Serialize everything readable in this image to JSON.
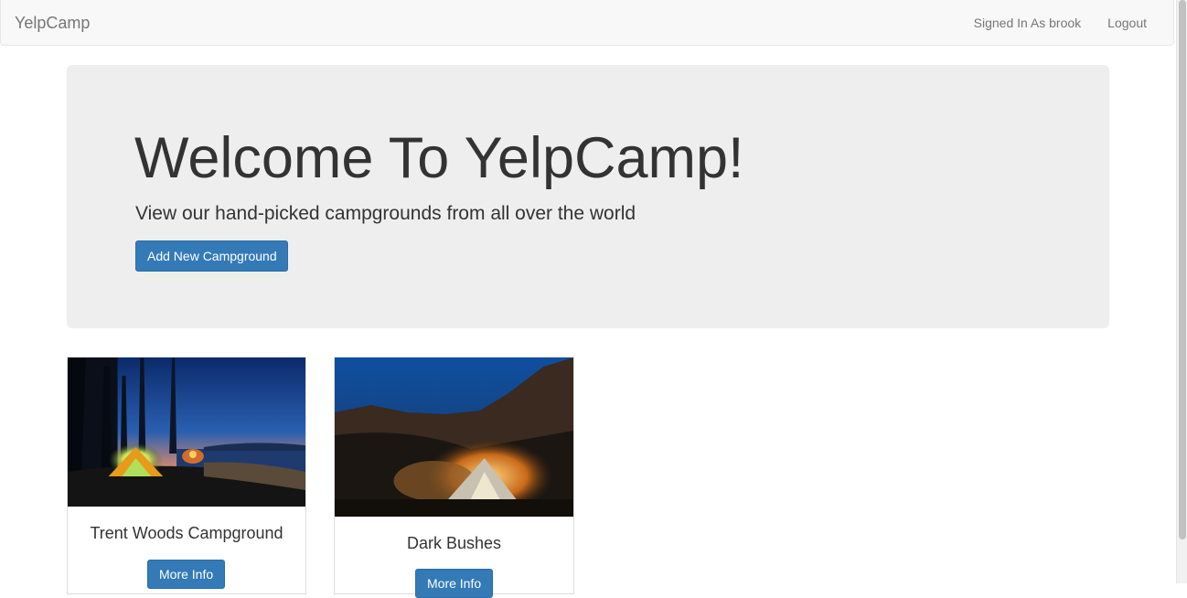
{
  "navbar": {
    "brand": "YelpCamp",
    "user_label": "Signed In As brook",
    "logout_label": "Logout"
  },
  "jumbotron": {
    "title": "Welcome To YelpCamp!",
    "subtitle": "View our hand-picked campgrounds from all over the world",
    "add_button_label": "Add New Campground"
  },
  "campgrounds": [
    {
      "name": "Trent Woods Campground",
      "button_label": "More Info"
    },
    {
      "name": "Dark Bushes",
      "button_label": "More Info"
    }
  ],
  "colors": {
    "primary": "#337ab7",
    "navbar_bg": "#f8f8f8",
    "jumbotron_bg": "#eeeeee"
  }
}
